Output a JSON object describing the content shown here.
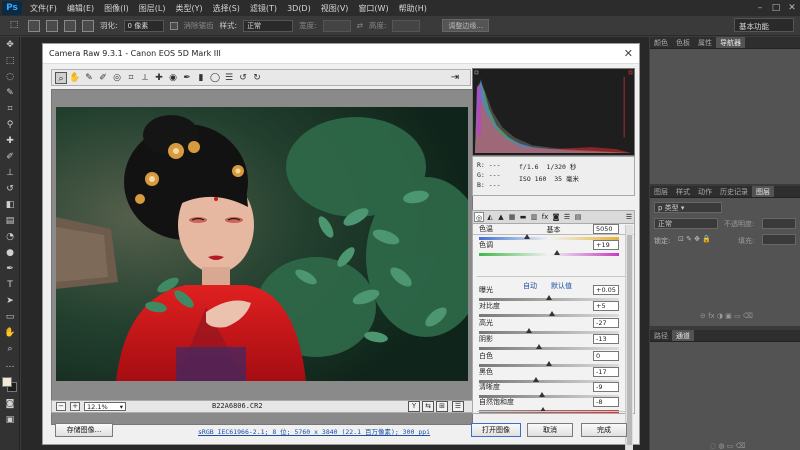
{
  "app": {
    "logo": "Ps",
    "menu": [
      "文件(F)",
      "编辑(E)",
      "图像(I)",
      "图层(L)",
      "类型(Y)",
      "选择(S)",
      "滤镜(T)",
      "3D(D)",
      "视图(V)",
      "窗口(W)",
      "帮助(H)"
    ],
    "window_controls": [
      "–",
      "□",
      "✕"
    ]
  },
  "options": {
    "feather_label": "羽化:",
    "feather_value": "0 像素",
    "antialias_label": "消除锯齿",
    "style_label": "样式:",
    "style_value": "正常",
    "width_label": "宽度:",
    "height_label": "高度:",
    "refine_edge_label": "调整边缘...",
    "workspace": "基本功能"
  },
  "right_panels": {
    "top_tabs": [
      "颜色",
      "色板",
      "属性",
      "导航器"
    ],
    "layers_tabs": [
      "图层",
      "样式",
      "动作",
      "历史记录",
      "图层"
    ],
    "blend_mode": "正常",
    "opacity_label": "不透明度:",
    "lock_label": "锁定:",
    "fill_label": "填充:",
    "bottom_tabs": [
      "路径",
      "通道"
    ]
  },
  "camera_raw": {
    "title": "Camera Raw 9.3.1 -  Canon EOS 5D Mark III",
    "close": "✕",
    "zoom": "12.1%",
    "filename": "B22A6806.CR2",
    "rgb": [
      "R:  ---",
      "G:  ---",
      "B:  ---"
    ],
    "exif": {
      "aperture": "f/1.6",
      "shutter": "1/320 秒",
      "iso": "ISO 160",
      "focal": "35 毫米"
    },
    "panel_title": "基本",
    "auto_label": "自动",
    "default_label": "默认值",
    "sliders": [
      {
        "label": "色温",
        "value": "5050",
        "pos": 0.34,
        "track": "temp"
      },
      {
        "label": "色调",
        "value": "+19",
        "pos": 0.56,
        "track": "tint"
      },
      {
        "label": "曝光",
        "value": "+0.05",
        "pos": 0.5,
        "track": "gray"
      },
      {
        "label": "对比度",
        "value": "+5",
        "pos": 0.52,
        "track": "gray"
      },
      {
        "label": "高光",
        "value": "-27",
        "pos": 0.36,
        "track": "gray"
      },
      {
        "label": "阴影",
        "value": "-13",
        "pos": 0.43,
        "track": "gray"
      },
      {
        "label": "白色",
        "value": "0",
        "pos": 0.5,
        "track": "gray"
      },
      {
        "label": "黑色",
        "value": "-17",
        "pos": 0.41,
        "track": "gray"
      },
      {
        "label": "清晰度",
        "value": "-9",
        "pos": 0.45,
        "track": "gray"
      },
      {
        "label": "自然饱和度",
        "value": "-8",
        "pos": 0.46,
        "track": "sat"
      }
    ],
    "save_button": "存储图像...",
    "workflow_text": "sRGB IEC61966-2.1; 8 位; 5760 x 3840 (22.1 百万像素); 300 ppi",
    "open_button": "打开图像",
    "cancel_button": "取消",
    "done_button": "完成"
  }
}
